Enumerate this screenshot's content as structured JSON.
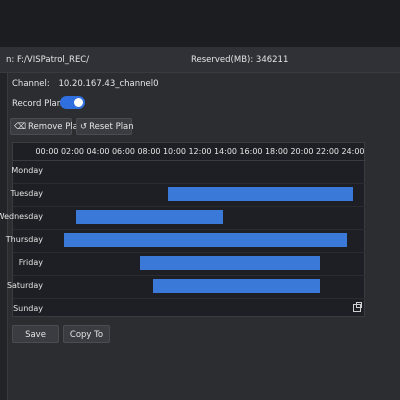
{
  "info": {
    "path_text": "n: F:/VISPatrol_REC/",
    "reserved_text": "Reserved(MB):  346211"
  },
  "channel": {
    "label": "Channel:",
    "value": "10.20.167.43_channel0"
  },
  "record_plan": {
    "label": "Record Plan",
    "enabled": true
  },
  "toolbar": {
    "remove_label": "Remove Plan",
    "reset_label": "Reset Plan"
  },
  "schedule": {
    "hours": [
      "00:00",
      "02:00",
      "04:00",
      "06:00",
      "08:00",
      "10:00",
      "12:00",
      "14:00",
      "16:00",
      "18:00",
      "20:00",
      "22:00",
      "24:00"
    ],
    "days": [
      {
        "label": "Monday",
        "ranges": []
      },
      {
        "label": "Tuesday",
        "ranges": [
          [
            9.5,
            24.0
          ]
        ]
      },
      {
        "label": "Wednesday",
        "ranges": [
          [
            2.3,
            13.8
          ]
        ]
      },
      {
        "label": "Thursday",
        "ranges": [
          [
            1.3,
            23.5
          ]
        ]
      },
      {
        "label": "Friday",
        "ranges": [
          [
            7.3,
            21.4
          ]
        ]
      },
      {
        "label": "Saturday",
        "ranges": [
          [
            8.3,
            21.4
          ]
        ]
      },
      {
        "label": "Sunday",
        "ranges": []
      }
    ],
    "bar_color": "#3a79d8",
    "corner_icon": "copy-icon"
  },
  "footer": {
    "save_label": "Save",
    "copy_label": "Copy To"
  }
}
